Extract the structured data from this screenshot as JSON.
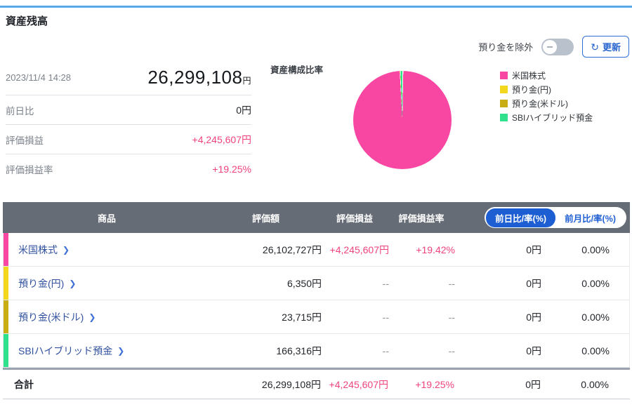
{
  "page": {
    "title": "資産残高"
  },
  "controls": {
    "exclude_toggle_label": "預り金を除外",
    "toggle_state": "off",
    "refresh_button_label": "更新",
    "refresh_icon": "↻"
  },
  "summary": {
    "timestamp": "2023/11/4 14:28",
    "total_amount": "26,299,108",
    "currency_suffix": "円",
    "rows": [
      {
        "label": "前日比",
        "value": "0円"
      },
      {
        "label": "評価損益",
        "value": "+4,245,607円"
      },
      {
        "label": "評価損益率",
        "value": "+19.25%"
      }
    ]
  },
  "pie": {
    "title": "資産構成比率"
  },
  "legend": [
    {
      "label": "米国株式",
      "color": "#f747a3"
    },
    {
      "label": "預り金(円)",
      "color": "#f2d71c"
    },
    {
      "label": "預り金(米ドル)",
      "color": "#c8ad15"
    },
    {
      "label": "SBIハイブリッド預金",
      "color": "#2fe08c"
    }
  ],
  "chart_data": {
    "type": "pie",
    "title": "資産構成比率",
    "labels": [
      "米国株式",
      "預り金(円)",
      "預り金(米ドル)",
      "SBIハイブリッド預金"
    ],
    "values": [
      26102727,
      6350,
      23715,
      166316
    ],
    "percents": [
      99.25,
      0.02,
      0.09,
      0.63
    ],
    "colors": [
      "#f747a3",
      "#f2d71c",
      "#c8ad15",
      "#2fe08c"
    ],
    "legend_position": "right"
  },
  "table": {
    "headers": {
      "product": "商品",
      "value": "評価額",
      "pl": "評価損益",
      "pl_rate": "評価損益率"
    },
    "period_toggle": {
      "active": "前日比/率(%)",
      "inactive": "前月比/率(%)"
    },
    "chevron": "❯",
    "rows": [
      {
        "name": "米国株式",
        "value": "26,102,727円",
        "pl": "+4,245,607円",
        "pl_rate": "+19.42%",
        "day_change": "0円",
        "day_rate": "0.00%"
      },
      {
        "name": "預り金(円)",
        "value": "6,350円",
        "pl": "--",
        "pl_rate": "--",
        "day_change": "0円",
        "day_rate": "0.00%"
      },
      {
        "name": "預り金(米ドル)",
        "value": "23,715円",
        "pl": "--",
        "pl_rate": "--",
        "day_change": "0円",
        "day_rate": "0.00%"
      },
      {
        "name": "SBIハイブリッド預金",
        "value": "166,316円",
        "pl": "--",
        "pl_rate": "--",
        "day_change": "0円",
        "day_rate": "0.00%"
      }
    ],
    "total": {
      "name": "合計",
      "value": "26,299,108円",
      "pl": "+4,245,607円",
      "pl_rate": "+19.25%",
      "day_change": "0円",
      "day_rate": "0.00%"
    }
  },
  "colors": {
    "accent_line": "#58a8e9",
    "positive_pink": "#f0437b",
    "link_blue": "#3252a0",
    "table_header_gray": "#666c75",
    "toggle_active_blue": "#1d5ed2",
    "toggle_off_gray": "#b9c1cd"
  }
}
